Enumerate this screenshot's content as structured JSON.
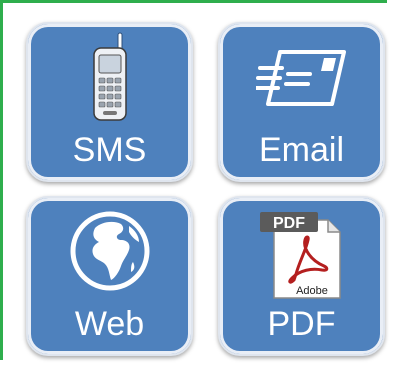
{
  "tiles": [
    {
      "label": "SMS",
      "icon": "mobile-phone-icon"
    },
    {
      "label": "Email",
      "icon": "envelope-icon"
    },
    {
      "label": "Web",
      "icon": "globe-icon"
    },
    {
      "label": "PDF",
      "icon": "pdf-document-icon"
    }
  ],
  "pdf_icon": {
    "badge_text": "PDF",
    "brand_text": "Adobe"
  },
  "colors": {
    "tile_background": "#4e81bd",
    "tile_border": "#dfe5ee",
    "frame_border": "#2fae4d",
    "label_text": "#ffffff"
  }
}
